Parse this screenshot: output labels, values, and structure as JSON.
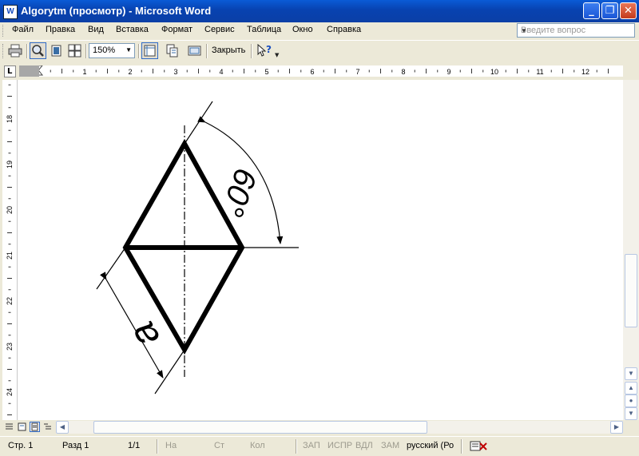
{
  "window": {
    "title": "Algorytm (просмотр) - Microsoft Word",
    "app_icon_letter": "W",
    "minimize_glyph": "_",
    "maximize_glyph": "❐",
    "close_glyph": "✕"
  },
  "menu": {
    "items": [
      "Файл",
      "Правка",
      "Вид",
      "Вставка",
      "Формат",
      "Сервис",
      "Таблица",
      "Окно",
      "Справка"
    ],
    "help_placeholder": "Введите вопрос"
  },
  "toolbar": {
    "zoom": "150%",
    "close_label": "Закрыть",
    "icons": [
      "print-icon",
      "magnifier-icon",
      "one-page-icon",
      "multiple-pages-icon",
      "view-ruler-icon",
      "shrink-to-fit-icon",
      "full-screen-icon",
      "context-help-icon"
    ]
  },
  "rulers": {
    "horizontal_labels": [
      "1",
      "2",
      "3",
      "4",
      "5",
      "6",
      "7",
      "8",
      "9",
      "10",
      "11",
      "12"
    ],
    "vertical_labels": [
      "18",
      "19",
      "20",
      "21",
      "22",
      "23",
      "24"
    ],
    "tab_selector": "L"
  },
  "document": {
    "angle_label": "60°",
    "side_label": "a"
  },
  "status": {
    "page": "Стр. 1",
    "section": "Разд 1",
    "pages": "1/1",
    "at": "На",
    "line": "Ст",
    "column": "Кол",
    "rec": "ЗАП",
    "trk": "ИСПР",
    "ext": "ВДЛ",
    "ovr": "ЗАМ",
    "language": "русский (Ро"
  }
}
